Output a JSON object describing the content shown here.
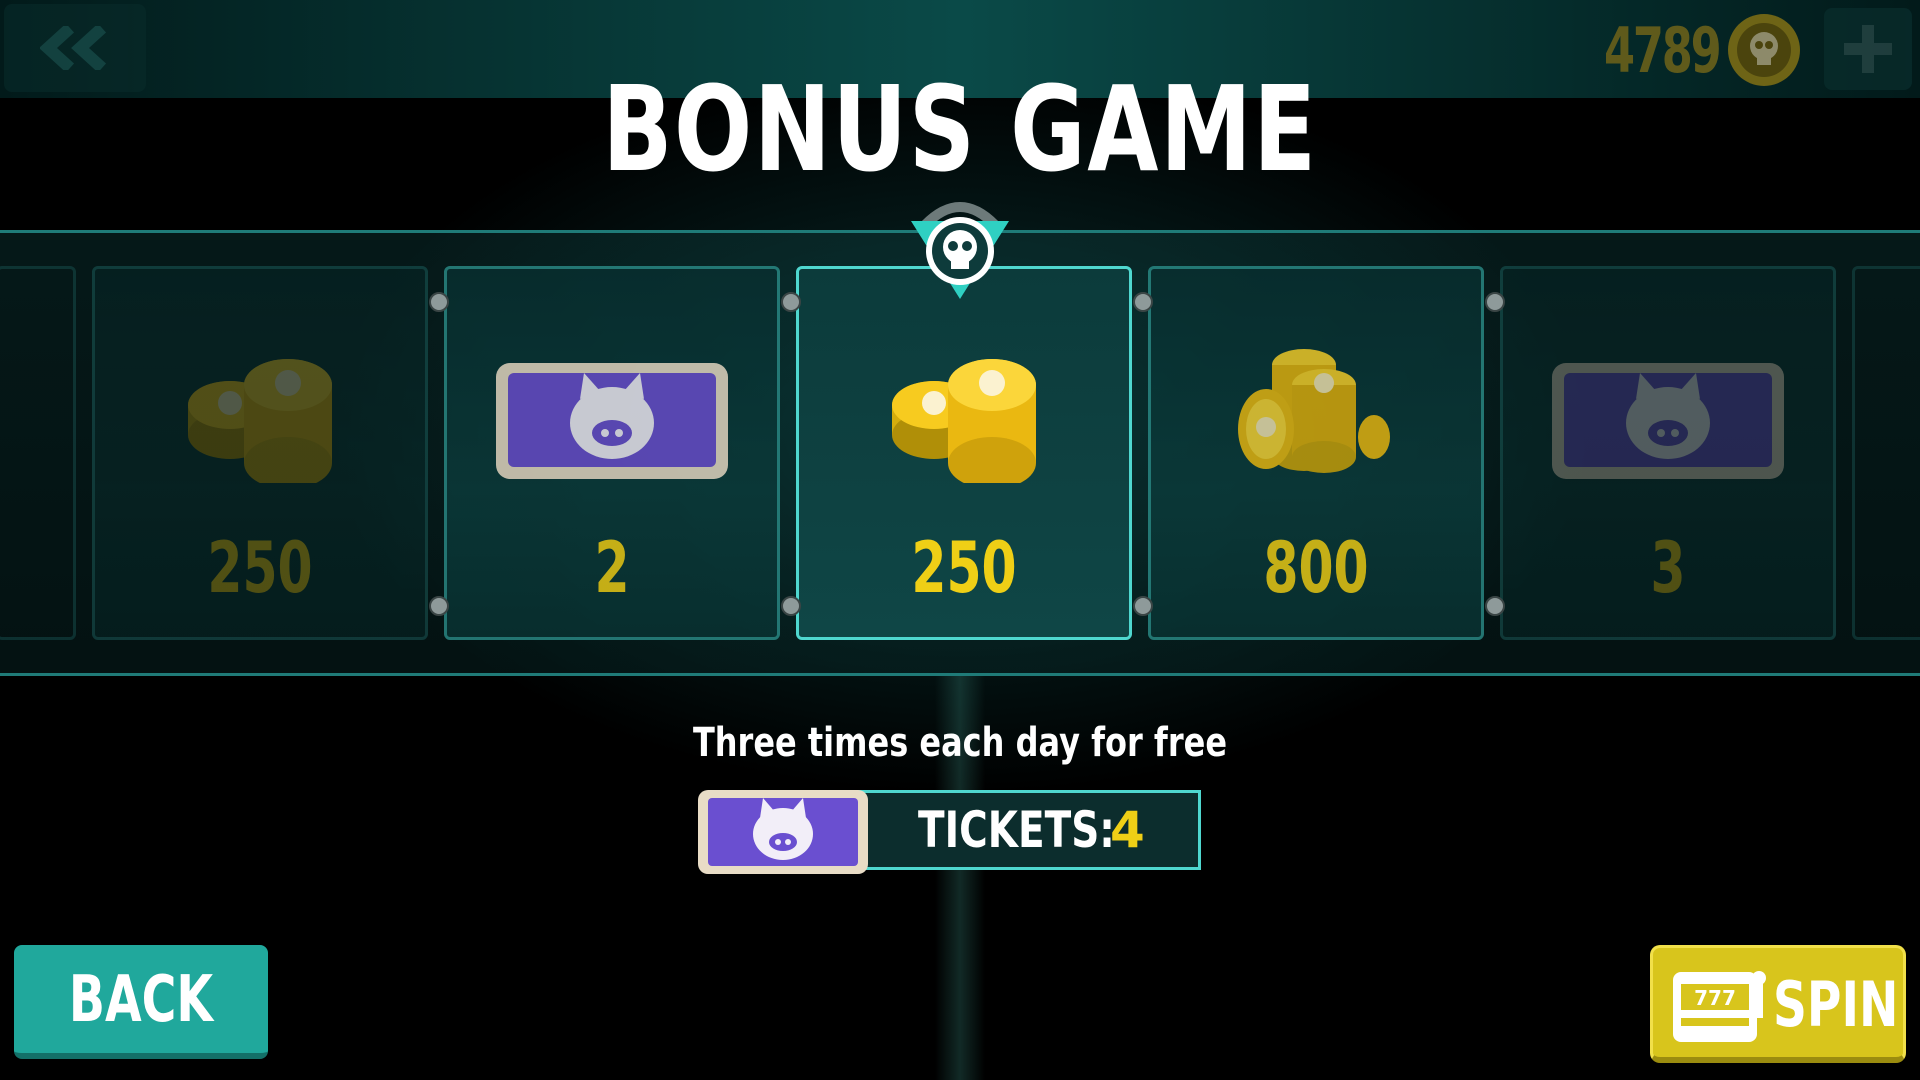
{
  "header": {
    "coins": "4789",
    "icons": {
      "back": "double-chevron-left-icon",
      "currency": "skull-coin-icon",
      "add": "plus-icon"
    }
  },
  "title": "BONUS GAME",
  "prizes": [
    {
      "value": "250",
      "icon": "coin-stack-icon",
      "state": "dim"
    },
    {
      "value": "2",
      "icon": "pig-ticket-icon",
      "state": "semi"
    },
    {
      "value": "250",
      "icon": "coin-stack-icon",
      "state": "selected"
    },
    {
      "value": "800",
      "icon": "coin-pile-icon",
      "state": "semi"
    },
    {
      "value": "3",
      "icon": "pig-ticket-icon",
      "state": "dim"
    }
  ],
  "pointer_icon": "skull-badge-icon",
  "info": {
    "subtitle": "Three times each day for free",
    "tickets_label": "TICKETS:",
    "tickets_count": "4"
  },
  "buttons": {
    "back": "BACK",
    "spin": "SPIN"
  },
  "colors": {
    "accent_teal": "#20a89c",
    "accent_yellow": "#efcf16",
    "ticket_purple": "#6a4fd0"
  }
}
